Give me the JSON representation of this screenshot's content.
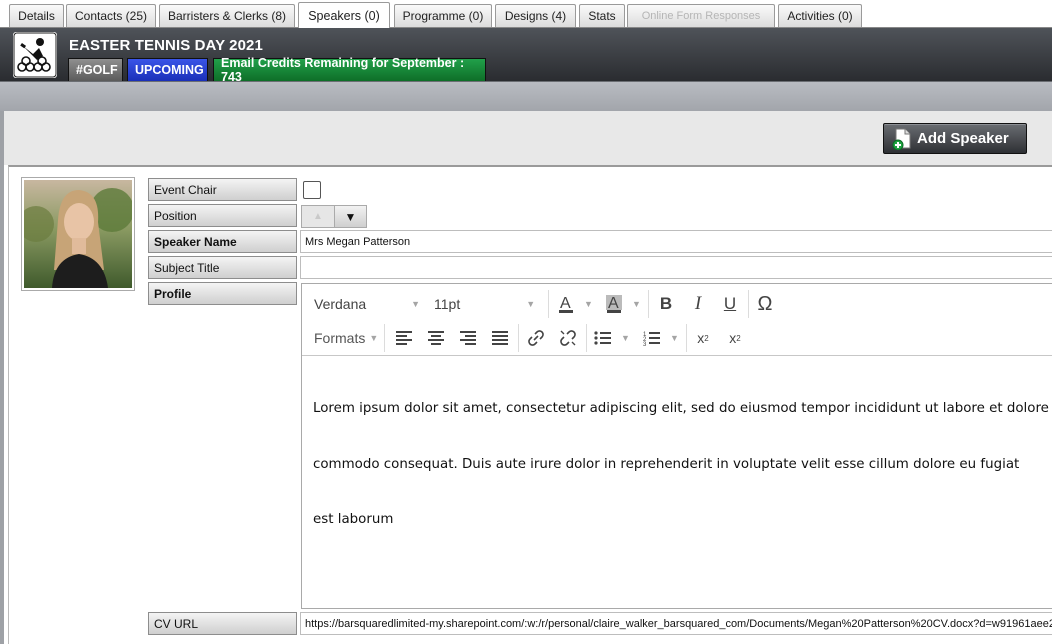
{
  "tabs": [
    {
      "label": "Details"
    },
    {
      "label": "Contacts (25)"
    },
    {
      "label": "Barristers & Clerks (8)"
    },
    {
      "label": "Speakers (0)"
    },
    {
      "label": "Programme (0)"
    },
    {
      "label": "Designs (4)"
    },
    {
      "label": "Stats"
    },
    {
      "label": "Online Form Responses"
    },
    {
      "label": "Activities (0)"
    }
  ],
  "event": {
    "title": "EASTER TENNIS DAY 2021",
    "tag": "#GOLF",
    "status": "UPCOMING",
    "credits": "Email Credits Remaining for September : 743"
  },
  "actions": {
    "add_speaker": "Add Speaker"
  },
  "form": {
    "event_chair_label": "Event Chair",
    "position_label": "Position",
    "speaker_name_label": "Speaker Name",
    "speaker_name_value": "Mrs Megan Patterson",
    "subject_title_label": "Subject Title",
    "subject_title_value": "",
    "profile_label": "Profile",
    "cv_url_label": "CV URL",
    "cv_url_value": "https://barsquaredlimited-my.sharepoint.com/:w:/r/personal/claire_walker_barsquared_com/Documents/Megan%20Patterson%20CV.docx?d=w91961aee2"
  },
  "editor": {
    "font_family": "Verdana",
    "font_size": "11pt",
    "formats_label": "Formats",
    "content_lines": [
      "Lorem ipsum dolor sit amet, consectetur adipiscing elit, sed do eiusmod tempor incididunt ut labore et dolore",
      "commodo consequat. Duis aute irure dolor in reprehenderit in voluptate velit esse cillum dolore eu fugiat",
      "est laborum"
    ]
  },
  "colors": {
    "upcoming_badge": "#1a2fb8",
    "credits_badge": "#0e6e28",
    "golf_badge": "#5b5b5b"
  },
  "icons": [
    "bold-icon",
    "italic-icon",
    "underline-icon",
    "omega-icon",
    "link-icon",
    "unlink-icon",
    "bullet-list-icon",
    "numbered-list-icon",
    "superscript-icon",
    "subscript-icon"
  ]
}
